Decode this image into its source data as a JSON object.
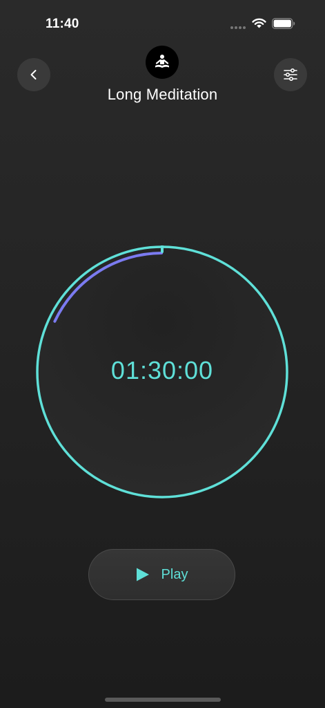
{
  "status_bar": {
    "time": "11:40"
  },
  "header": {
    "title": "Long Meditation",
    "back_icon": "chevron-left-icon",
    "badge_icon": "meditation-person-icon",
    "settings_icon": "sliders-icon"
  },
  "timer": {
    "display": "01:30:00",
    "elapsed_fraction": 0.18
  },
  "controls": {
    "play_label": "Play",
    "play_icon": "play-icon"
  },
  "colors": {
    "background": "#242424",
    "accent_teal": "#5fe0d8",
    "accent_purple": "#7b7bf0",
    "button_bg": "#3a3a3a"
  }
}
